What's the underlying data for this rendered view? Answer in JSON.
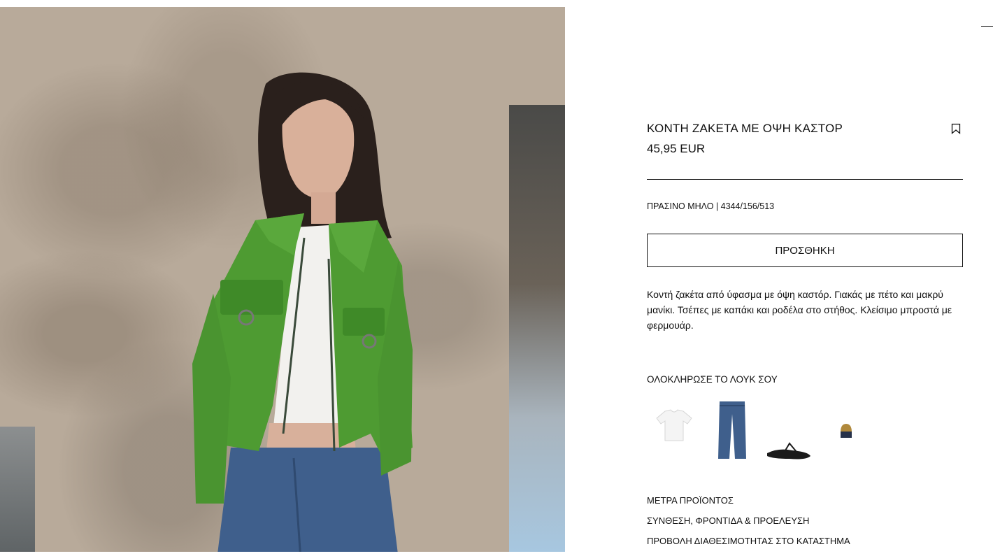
{
  "product": {
    "title": "ΚΟΝΤΗ ΖΑΚΕΤΑ ΜΕ ΟΨΗ ΚΑΣΤΟΡ",
    "price": "45,95 EUR",
    "color_ref": "ΠΡΑΣΙΝΟ ΜΗΛΟ | 4344/156/513",
    "add_button": "ΠΡΟΣΘΗΚΗ",
    "description": "Κοντή ζακέτα από ύφασμα με όψη καστόρ. Γιακάς με πέτο και μακρύ μανίκι. Τσέπες με καπάκι και ροδέλα στο στήθος. Κλείσιμο μπροστά με φερμουάρ."
  },
  "look": {
    "heading": "ΟΛΟΚΛΗΡΩΣΕ ΤΟ ΛΟΥΚ ΣΟΥ",
    "items": [
      "white-tshirt",
      "blue-jeans",
      "black-sandals",
      "beanie-hat"
    ]
  },
  "links": [
    "ΜΕΤΡΑ ΠΡΟΪΟΝΤΟΣ",
    "ΣΥΝΘΕΣΗ, ΦΡΟΝΤΙΔΑ & ΠΡΟΕΛΕΥΣΗ",
    "ΠΡΟΒΟΛΗ ΔΙΑΘΕΣΙΜΟΤΗΤΑΣ ΣΤΟ ΚΑΤΑΣΤΗΜΑ"
  ],
  "icons": {
    "bookmark": "bookmark-icon",
    "close": "close-icon"
  },
  "colors": {
    "text": "#111111",
    "jacket": "#4e9b32",
    "jeans": "#3f5f8c"
  }
}
